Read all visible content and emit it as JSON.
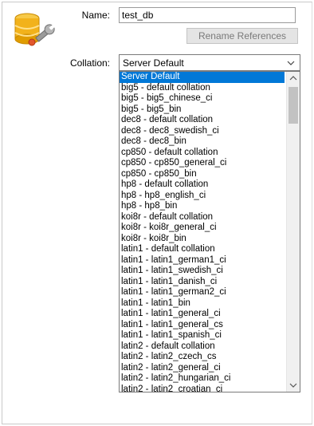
{
  "form": {
    "name_label": "Name:",
    "name_value": "test_db",
    "rename_button": "Rename References",
    "collation_label": "Collation:",
    "collation_value": "Server Default"
  },
  "dropdown": {
    "selected_index": 0,
    "options": [
      "Server Default",
      "big5 - default collation",
      "big5 - big5_chinese_ci",
      "big5 - big5_bin",
      "dec8 - default collation",
      "dec8 - dec8_swedish_ci",
      "dec8 - dec8_bin",
      "cp850 - default collation",
      "cp850 - cp850_general_ci",
      "cp850 - cp850_bin",
      "hp8 - default collation",
      "hp8 - hp8_english_ci",
      "hp8 - hp8_bin",
      "koi8r - default collation",
      "koi8r - koi8r_general_ci",
      "koi8r - koi8r_bin",
      "latin1 - default collation",
      "latin1 - latin1_german1_ci",
      "latin1 - latin1_swedish_ci",
      "latin1 - latin1_danish_ci",
      "latin1 - latin1_german2_ci",
      "latin1 - latin1_bin",
      "latin1 - latin1_general_ci",
      "latin1 - latin1_general_cs",
      "latin1 - latin1_spanish_ci",
      "latin2 - default collation",
      "latin2 - latin2_czech_cs",
      "latin2 - latin2_general_ci",
      "latin2 - latin2_hungarian_ci",
      "latin2 - latin2_croatian_ci"
    ]
  },
  "icons": {
    "database": "database-settings-icon",
    "dropdown_arrow": "chevron-down-icon",
    "scroll_up": "chevron-up-icon",
    "scroll_down": "chevron-down-icon"
  },
  "colors": {
    "selection": "#0078d7",
    "database_yellow": "#f2b21b",
    "wrench_gray": "#8f8f8f"
  }
}
